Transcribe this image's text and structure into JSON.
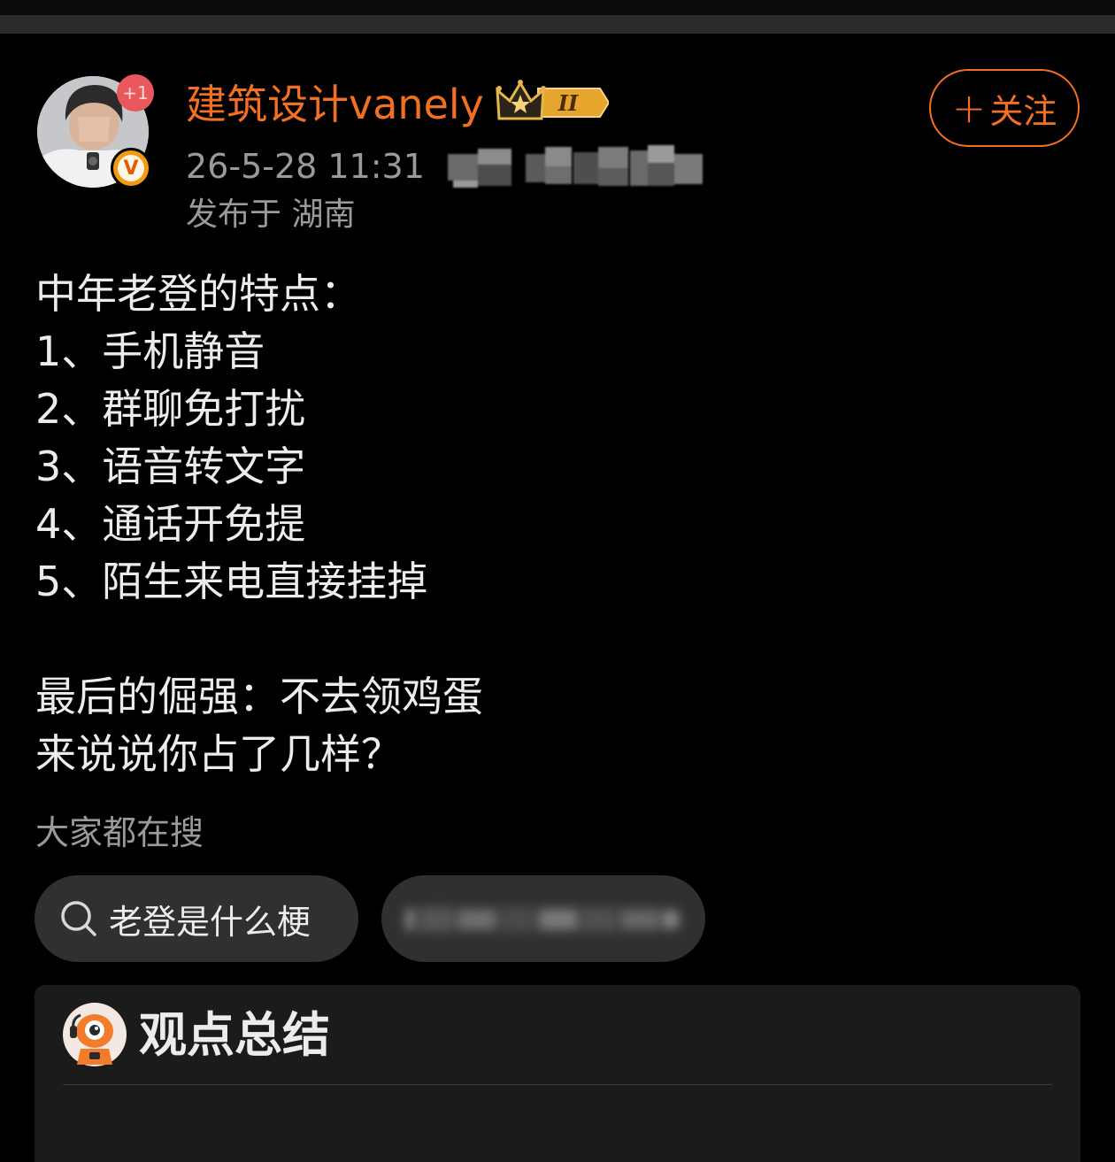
{
  "author": {
    "name": "建筑设计vanely",
    "avatar_badge": "+1",
    "verified_badge": "V",
    "vip_level": "II",
    "post_time": "26-5-28 11:31",
    "location": "发布于 湖南"
  },
  "follow_button": {
    "icon": "plus-icon",
    "label": "关注"
  },
  "post": {
    "lines": [
      "中年老登的特点：",
      "1、手机静音",
      "2、群聊免打扰",
      "3、语音转文字",
      "4、通话开免提",
      "5、陌生来电直接挂掉",
      "最后的倔强：不去领鸡蛋",
      "来说说你占了几样？"
    ]
  },
  "search": {
    "heading": "大家都在搜",
    "chips": [
      {
        "icon": "search-icon",
        "label": "老登是什么梗"
      }
    ]
  },
  "summary_card": {
    "icon": "robot-icon",
    "title": "观点总结"
  },
  "colors": {
    "accent": "#f27023",
    "background": "#000000",
    "text": "#ececec",
    "muted_text": "#9a9a9a",
    "chip_bg": "#303030",
    "card_bg": "#1b1b1b"
  }
}
